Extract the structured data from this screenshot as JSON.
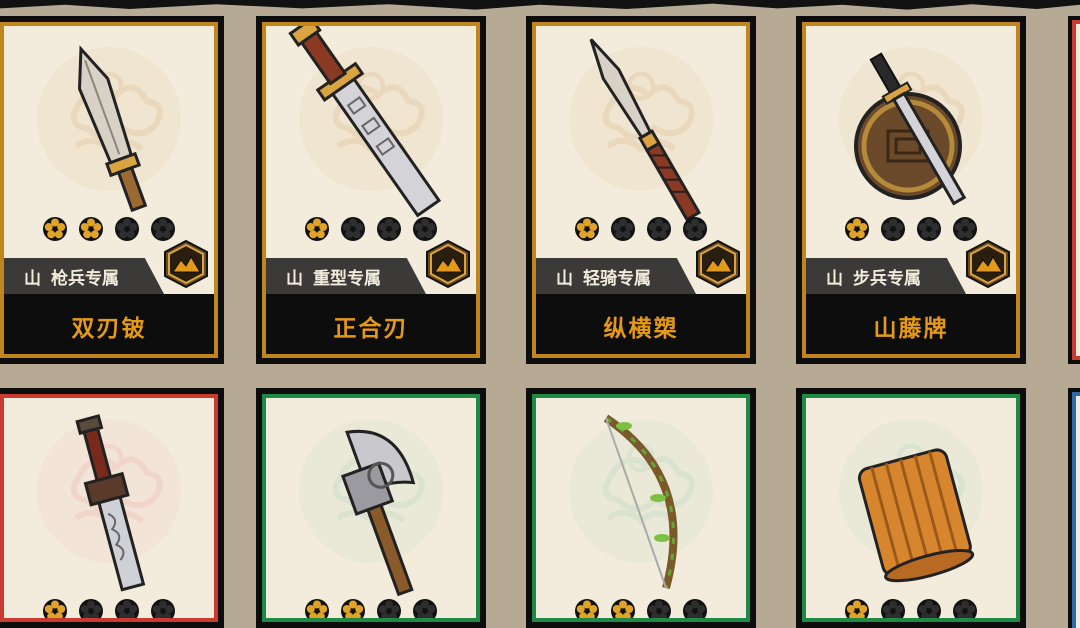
{
  "colors": {
    "frame_gold": "#c0851c",
    "frame_red": "#c93a30",
    "frame_green": "#1e8a46",
    "frame_blue": "#2f6aa8",
    "card_bg": "#f3ecdc",
    "name_text": "#e59a17",
    "star_filled": "#e0a227",
    "star_empty": "#2e2e2e"
  },
  "cards": [
    {
      "name": "双刃铍",
      "terrain": "山",
      "type": "枪兵专属",
      "stars": 2,
      "frame": "gold",
      "cloud": "#e2c9a3",
      "weapon": "spearhead",
      "weapon_icon": "spear-blade-icon"
    },
    {
      "name": "正合刃",
      "terrain": "山",
      "type": "重型专属",
      "stars": 1,
      "frame": "gold",
      "cloud": "#e2c9a3",
      "weapon": "broadsword",
      "weapon_icon": "broadsword-icon"
    },
    {
      "name": "纵横槊",
      "terrain": "山",
      "type": "轻骑专属",
      "stars": 1,
      "frame": "gold",
      "cloud": "#e2c9a3",
      "weapon": "lance",
      "weapon_icon": "lance-icon"
    },
    {
      "name": "山藤牌",
      "terrain": "山",
      "type": "步兵专属",
      "stars": 1,
      "frame": "gold",
      "cloud": "#e2c9a3",
      "weapon": "shield",
      "weapon_icon": "round-shield-sword-icon"
    },
    {
      "name": "",
      "terrain": "",
      "type": "",
      "stars": 1,
      "frame": "red",
      "cloud": "#efc4bd",
      "weapon": "dagger",
      "weapon_icon": "short-sword-icon"
    },
    {
      "name": "",
      "terrain": "",
      "type": "",
      "stars": 2,
      "frame": "green",
      "cloud": "#c5dcc5",
      "weapon": "axe",
      "weapon_icon": "battle-axe-icon"
    },
    {
      "name": "",
      "terrain": "",
      "type": "",
      "stars": 2,
      "frame": "green",
      "cloud": "#c5dcc5",
      "weapon": "bow",
      "weapon_icon": "vine-bow-icon"
    },
    {
      "name": "",
      "terrain": "",
      "type": "",
      "stars": 1,
      "frame": "green",
      "cloud": "#c5dcc5",
      "weapon": "scroll",
      "weapon_icon": "bamboo-scroll-icon"
    }
  ]
}
